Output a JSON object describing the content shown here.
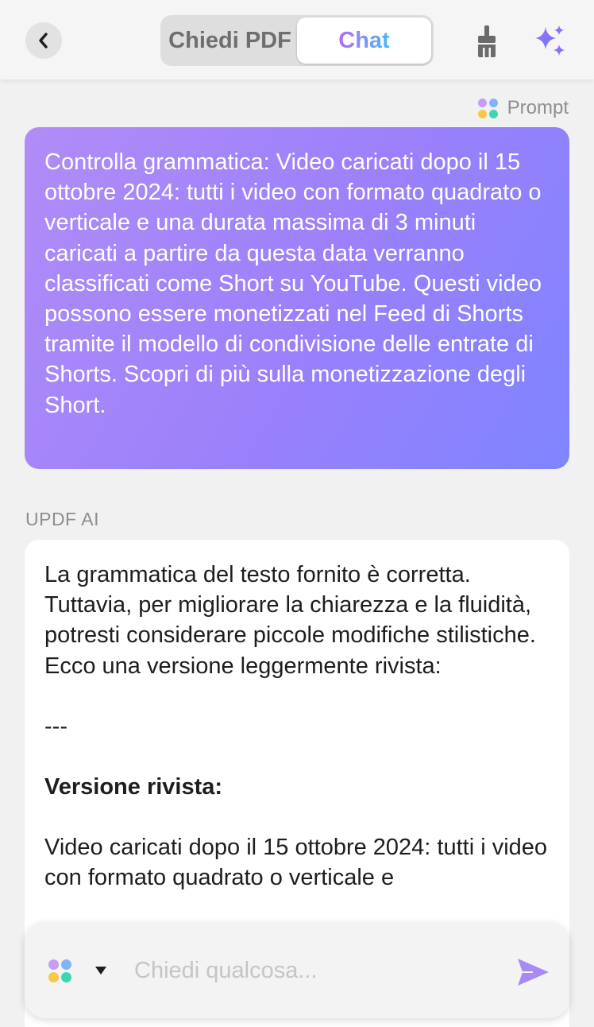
{
  "header": {
    "tabs": [
      {
        "label": "Chiedi PDF",
        "active": false
      },
      {
        "label": "Chat",
        "active": true
      }
    ]
  },
  "prompt": {
    "label": "Prompt",
    "text": "Controlla grammatica: Video caricati dopo il 15 ottobre 2024: tutti i video con formato quadrato o verticale e una durata massima di 3 minuti caricati a partire da questa data verranno classificati come Short su YouTube. Questi video possono essere monetizzati nel Feed di Shorts tramite il modello di condivisione delle entrate di Shorts. Scopri di più sulla monetizzazione degli Short."
  },
  "answer": {
    "sender": "UPDF AI",
    "intro": "La grammatica del testo fornito è corretta. Tuttavia, per migliorare la chiarezza e la fluidità, potresti considerare piccole modifiche stilistiche. Ecco una versione leggermente rivista:",
    "separator": "---",
    "revised_heading": "Versione rivista:",
    "revised_text": "Video caricati dopo il 15 ottobre 2024: tutti i video con formato quadrato o verticale e"
  },
  "input": {
    "placeholder": "Chiedi qualcosa..."
  },
  "icons": {
    "back": "chevron-left-icon",
    "clear": "broom-icon",
    "ai": "sparkle-icon",
    "model": "four-dots-icon",
    "model_menu": "caret-down-icon",
    "send": "send-icon"
  },
  "colors": {
    "accent_purple": "#9a80fb",
    "accent_blue": "#4cb8f7",
    "send": "#a88af5",
    "dot_purple": "#c89bf5",
    "dot_blue": "#7fb4f7",
    "dot_yellow": "#f7c948",
    "dot_teal": "#3dd6b5"
  }
}
